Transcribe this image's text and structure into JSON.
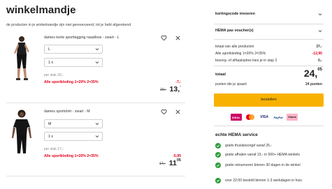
{
  "header": {
    "title": "winkelmandje",
    "subtitle": "de producten in je winkelmandje zijn niet gereserveerd, tot je hebt afgerekend"
  },
  "cart_items": [
    {
      "name": "dames korte sportlegging naadloos - zwart - L",
      "size": "L",
      "quantity": "1 x",
      "per_piece": "per stuk 20,-",
      "promo": "Alle sportkleding 1=20% 2=35%",
      "discount": "-7,-",
      "old_price": "20,-",
      "new_price_main": "13,",
      "new_price_sup": "-"
    },
    {
      "name": "dames sportshirt - zwart - M",
      "size": "M",
      "quantity": "1 x",
      "per_piece": "per stuk 17,-",
      "promo": "Alle sportkleding 1=20% 2=35%",
      "discount": "-5,95",
      "old_price": "17,-",
      "new_price_main": "11",
      "new_price_sup": "05"
    }
  ],
  "summary": {
    "discount_code_label": "kortingscode invoeren",
    "voucher_label": "HEMA pas voucher(s)",
    "rows": [
      {
        "label": "totaal van alle producten",
        "value": "37,-",
        "red": false
      },
      {
        "label": "Alle sportkleding 1=20% 2=35%",
        "value": "-12,95",
        "red": true
      },
      {
        "label": "bezorg- of afhaalopties kies je in stap 2",
        "value": "0,-",
        "red": false
      }
    ],
    "total_label": "totaal",
    "total_main": "24,",
    "total_sup": "05",
    "points_label": "punten die je spaart",
    "points_value": "24 punten",
    "checkout_label": "bestellen"
  },
  "payment_methods": [
    {
      "name": "iDEAL",
      "icon": "ideal-icon",
      "bg": "#cc0066",
      "fg": "#ffffff"
    },
    {
      "name": "MC",
      "icon": "mastercard-icon",
      "bg": "#ffffff",
      "fg": "#eb001b"
    },
    {
      "name": "VISA",
      "icon": "visa-icon",
      "bg": "#ffffff",
      "fg": "#1a1f71"
    },
    {
      "name": "PayPal",
      "icon": "paypal-icon",
      "bg": "#ffffff",
      "fg": "#003087"
    },
    {
      "name": "Klarna",
      "icon": "klarna-icon",
      "bg": "#ffb3c7",
      "fg": "#17120f"
    }
  ],
  "service": {
    "title": "echte HEMA service",
    "items": [
      "gratis thuisbezorgd vanaf 25,-",
      "gratis afhalen vanaf 15,- in 500+ HEMA winkels",
      "gratis retourneren binnen 30 dagen in de winkel",
      "voor 22:00 besteld binnen 1-3 werkdagen in huis"
    ]
  },
  "colors": {
    "accent": "#f8b100",
    "promo_red": "#e8001c",
    "check_green": "#2e9b3f"
  }
}
